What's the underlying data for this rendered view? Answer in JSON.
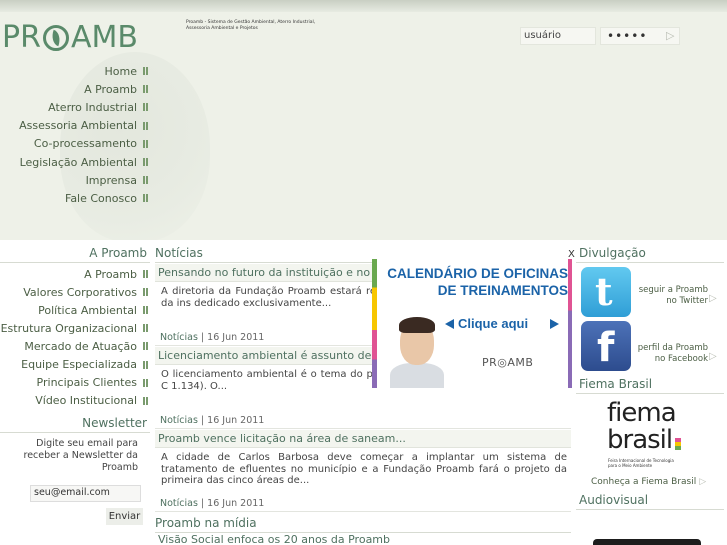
{
  "header": {
    "logo_text_left": "PR",
    "logo_text_right": "AMB",
    "tagline": "Proamb - Sistema de Gestão Ambiental, Aterro Industrial, Assessoria Ambiental e Projetos",
    "login": {
      "user_value": "usuário",
      "password_value": "•••••",
      "submit_arrow": "▷"
    }
  },
  "main_nav": {
    "items": [
      "Home",
      "A Proamb",
      "Aterro Industrial",
      "Assessoria Ambiental",
      "Co-processamento",
      "Legislação Ambiental",
      "Imprensa",
      "Fale Conosco"
    ]
  },
  "left": {
    "section_title": "A Proamb",
    "menu": [
      "A Proamb",
      "Valores Corporativos",
      "Política Ambiental",
      "Estrutura Organizacional",
      "Mercado de Atuação",
      "Equipe Especializada",
      "Principais Clientes",
      "Vídeo Institucional"
    ],
    "newsletter": {
      "title": "Newsletter",
      "text": "Digite seu email para receber a Newsletter da Proamb",
      "email_value": "seu@email.com",
      "send_label": "Enviar"
    }
  },
  "news": {
    "title": "Notícias",
    "items": [
      {
        "headline": "Pensando no futuro da instituição e no p",
        "body": "A diretoria da Fundação Proamb estará re revisão do planejamento estratégico da ins dedicado exclusivamente...",
        "category": "Notícias",
        "date": "16 Jun 2011"
      },
      {
        "headline": "Licenciamento ambiental é assunto de cu",
        "body": "O licenciamento ambiental é o tema do promove no dia 28 de junho, na CIC de C 1.134). O...",
        "category": "Notícias",
        "date": "16 Jun 2011"
      },
      {
        "headline": "Proamb vence licitação na área de saneam...",
        "body": "A cidade de Carlos Barbosa deve começar a implantar um sistema de tratamento de efluentes no município e a Fundação Proamb fará o projeto da primeira das cinco áreas de...",
        "category": "Notícias",
        "date": "16 Jun 2011"
      }
    ],
    "date_separator": " | ",
    "media_title": "Proamb na mídia",
    "media_headline": "Visão Social enfoca os 20 anos da Proamb"
  },
  "promo": {
    "title_line1": "CALENDÁRIO DE OFICINAS",
    "title_line2": "DE TREINAMENTOS",
    "cta": "Clique aqui",
    "brand": "PR◎AMB",
    "close": "X"
  },
  "right": {
    "divulgacao_title": "Divulgação",
    "twitter_label": "seguir a Proamb no Twitter",
    "facebook_label": "perfil da Proamb no Facebook",
    "arrow": "▷",
    "fiema_title": "Fiema Brasil",
    "fiema_logo_line1": "fiema",
    "fiema_logo_line2": "brasil",
    "fiema_logo_sub": "Feira Internacional de Tecnologia para o Meio Ambiente",
    "fiema_link": "Conheça a Fiema Brasil",
    "audiovisual_title": "Audiovisual"
  },
  "colors": {
    "accent_green": "#4f7160",
    "header_bg": "#eef1e8",
    "promo_blue": "#1b63a8"
  }
}
